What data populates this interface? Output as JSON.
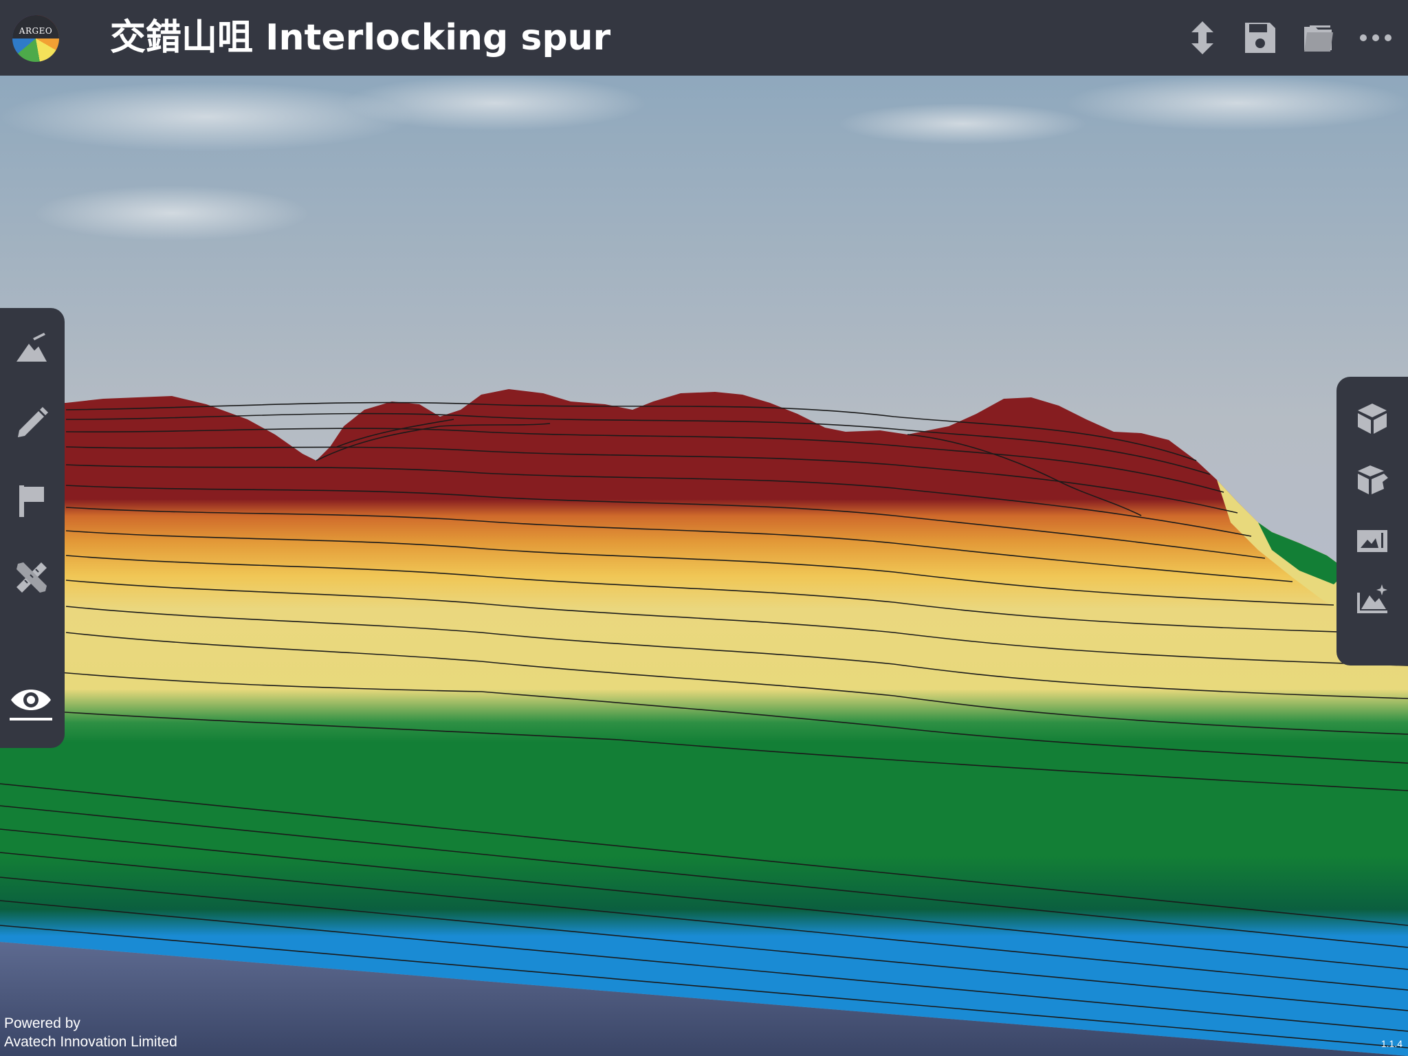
{
  "app": {
    "logo_text": "ARGEO",
    "title": "交錯山咀 Interlocking spur"
  },
  "toolbar": {
    "icons": [
      "upload-download-icon",
      "save-icon",
      "folder-icon",
      "more-icon"
    ]
  },
  "left_sidebar": {
    "icons": [
      "terrain-edit-icon",
      "pencil-icon",
      "flag-icon",
      "ruler-pencil-icon",
      "eye-icon"
    ]
  },
  "right_sidebar": {
    "icons": [
      "cube-top-icon",
      "cube-side-icon",
      "cross-section-icon",
      "terrain-sparkle-icon"
    ]
  },
  "footer": {
    "powered_line1": "Powered by",
    "powered_line2": "Avatech Innovation Limited",
    "version": "1.1.4"
  },
  "colors": {
    "toolbar_bg": "#343741",
    "peak": "#861d20",
    "orange": "#d9782f",
    "yellow": "#f0c655",
    "sand": "#e8d97c",
    "green": "#137f36",
    "dark_green": "#0b5f3f",
    "water": "#1a8bd4"
  }
}
